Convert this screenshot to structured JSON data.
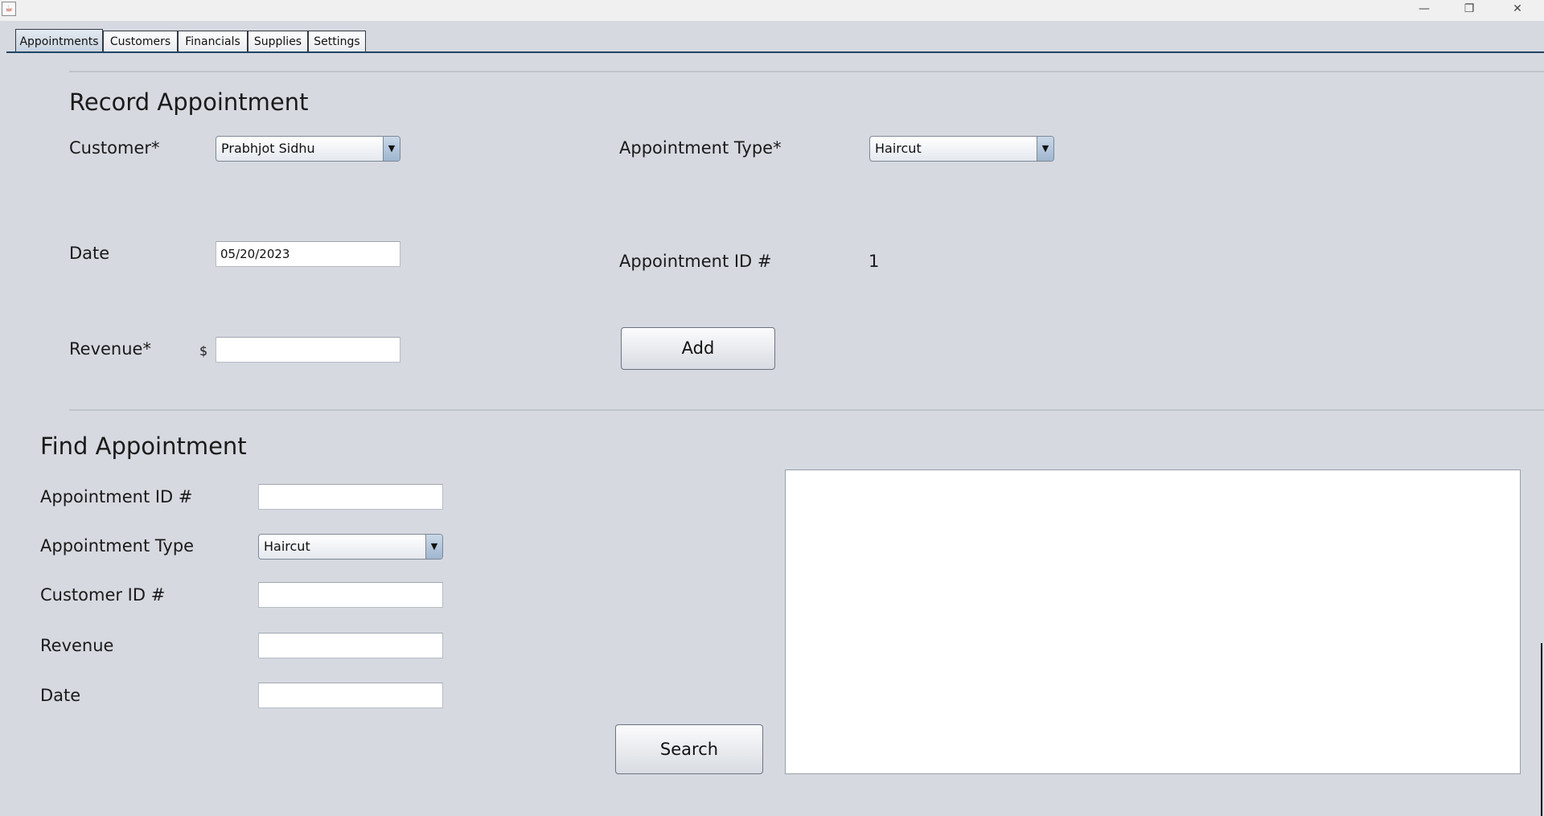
{
  "window": {
    "minimize_glyph": "—",
    "restore_glyph": "❐",
    "close_glyph": "✕"
  },
  "tabs": [
    {
      "label": "Appointments",
      "active": true
    },
    {
      "label": "Customers",
      "active": false
    },
    {
      "label": "Financials",
      "active": false
    },
    {
      "label": "Supplies",
      "active": false
    },
    {
      "label": "Settings",
      "active": false
    }
  ],
  "record": {
    "heading": "Record Appointment",
    "customer_label": "Customer*",
    "customer_value": "Prabhjot Sidhu",
    "appt_type_label": "Appointment Type*",
    "appt_type_value": "Haircut",
    "date_label": "Date",
    "date_value": "05/20/2023",
    "appt_id_label": "Appointment ID #",
    "appt_id_value": "1",
    "revenue_label": "Revenue*",
    "currency_symbol": "$",
    "revenue_value": "",
    "add_button": "Add"
  },
  "find": {
    "heading": "Find Appointment",
    "appt_id_label": "Appointment ID #",
    "appt_id_value": "",
    "appt_type_label": "Appointment Type",
    "appt_type_value": "Haircut",
    "customer_id_label": "Customer ID #",
    "customer_id_value": "",
    "revenue_label": "Revenue",
    "revenue_value": "",
    "date_label": "Date",
    "date_value": "",
    "search_button": "Search",
    "results_text": ""
  },
  "icons": {
    "combo_arrow": "▼"
  }
}
